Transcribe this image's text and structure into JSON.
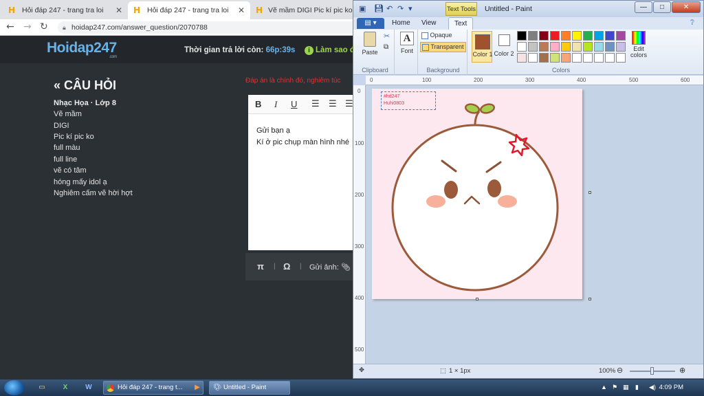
{
  "browser": {
    "tabs": [
      {
        "label": "Hỏi đáp 247 - trang tra loi",
        "active": false
      },
      {
        "label": "Hỏi đáp 247 - trang tra loi",
        "active": true
      },
      {
        "label": "Vẽ mầm DIGI Pic kí pic ko full",
        "active": false
      }
    ],
    "url": "hoidap247.com/answer_question/2070788"
  },
  "site": {
    "logo": "Hoidap247",
    "logo_sub": ".com",
    "timer_label": "Thời gian trả lời còn:",
    "timer_value": "66p:39s",
    "howto": "Làm sao đ"
  },
  "question": {
    "heading": "CÂU HỎI",
    "meta": "Nhạc Họa · Lớp 8",
    "lines": [
      "Vẽ mầm",
      "DIGI",
      "Pic kí pic ko",
      "full màu",
      "full line",
      "vẽ có  tâm",
      "hóng mấy idol ạ",
      "Nghiêm cấm vẽ hời hợt"
    ]
  },
  "answer": {
    "red_hint": "Đáp án là chính đó, nghiêm túc",
    "toolbar": {
      "bold": "B",
      "italic": "I",
      "underline": "U"
    },
    "text_line1": "Gửi bạn ạ",
    "text_line2": "Kí ở pic chụp màn hình nhé",
    "footer": {
      "pi": "π",
      "omega": "Ω",
      "send_image": "Gửi ảnh:"
    }
  },
  "paint": {
    "title": "Untitled - Paint",
    "text_tools": "Text Tools",
    "tabs": {
      "home": "Home",
      "view": "View",
      "text": "Text"
    },
    "ribbon": {
      "paste": "Paste",
      "font": "Font",
      "opaque": "Opaque",
      "transparent": "Transparent",
      "color1": "Color 1",
      "color2": "Color 2",
      "edit_colors": "Edit colors",
      "groups": {
        "clipboard": "Clipboard",
        "background": "Background",
        "colors": "Colors"
      }
    },
    "palette": [
      "#000000",
      "#7f7f7f",
      "#880015",
      "#ed1c24",
      "#ff7f27",
      "#fff200",
      "#22b14c",
      "#00a2e8",
      "#3f48cc",
      "#a349a4",
      "#ffffff",
      "#c3c3c3",
      "#b97a57",
      "#ffaec9",
      "#ffc90e",
      "#efe4b0",
      "#b5e61d",
      "#99d9ea",
      "#7092be",
      "#c8bfe7",
      "#f3e3e3",
      "#ffffff",
      "#a0704f",
      "#cfe37a",
      "#f6a478",
      "#ffffff",
      "#ffffff",
      "#ffffff",
      "#ffffff",
      "#ffffff"
    ],
    "color1": "#a0522d",
    "color2": "#ffffff",
    "ruler_h": [
      "0",
      "100",
      "200",
      "300",
      "400",
      "500",
      "600"
    ],
    "ruler_v": [
      "0",
      "100",
      "200",
      "300",
      "400",
      "500"
    ],
    "canvas_text": {
      "line1": "#hd247",
      "line2": "Huhi0803"
    },
    "status": {
      "size": "1 × 1px",
      "zoom": "100%"
    }
  },
  "taskbar": {
    "tasks": [
      {
        "label": "Hỏi đáp 247 - trang t..."
      },
      {
        "label": "Untitled - Paint"
      }
    ],
    "clock": "4:09 PM"
  },
  "colors": {
    "page_bg": "#2b3034",
    "brand_blue": "#69b2e8",
    "brand_green": "#9bd34c",
    "sprout_brown": "#a0522d",
    "sprout_green": "#9ccc4a",
    "angry_red": "#e0192a",
    "blush": "#f7b19a"
  }
}
